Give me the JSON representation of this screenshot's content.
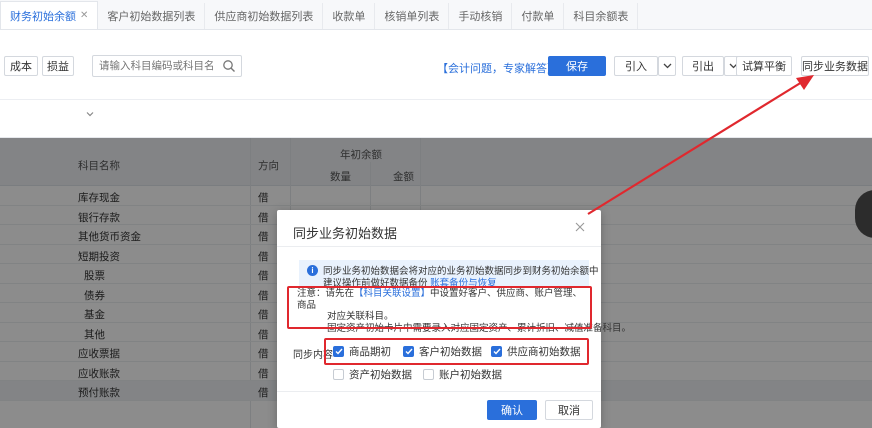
{
  "tabs": [
    {
      "label": "财务初始余额",
      "active": true,
      "closable": true
    },
    {
      "label": "客户初始数据列表"
    },
    {
      "label": "供应商初始数据列表"
    },
    {
      "label": "收款单"
    },
    {
      "label": "核销单列表"
    },
    {
      "label": "手动核销"
    },
    {
      "label": "付款单"
    },
    {
      "label": "科目余额表"
    }
  ],
  "toolbar": {
    "cost_label": "成本",
    "profit_loss_label": "损益",
    "search_placeholder": "请输入科目编码或科目名称",
    "help_link": "【会计问题，专家解答】",
    "save_label": "保存",
    "import_label": "引入",
    "export_label": "引出",
    "trial_balance_label": "试算平衡",
    "sync_label": "同步业务数据"
  },
  "grid": {
    "headers": {
      "account_name": "科目名称",
      "direction": "方向",
      "year_opening": "年初余额",
      "quantity": "数量",
      "amount": "金额"
    },
    "rows": [
      {
        "name": "库存现金",
        "dir": "借",
        "sub": false
      },
      {
        "name": "银行存款",
        "dir": "借",
        "sub": false
      },
      {
        "name": "其他货币资金",
        "dir": "借",
        "sub": false
      },
      {
        "name": "短期投资",
        "dir": "借",
        "sub": false
      },
      {
        "name": "股票",
        "dir": "借",
        "sub": true
      },
      {
        "name": "债券",
        "dir": "借",
        "sub": true
      },
      {
        "name": "基金",
        "dir": "借",
        "sub": true
      },
      {
        "name": "其他",
        "dir": "借",
        "sub": true
      },
      {
        "name": "应收票据",
        "dir": "借",
        "sub": false
      },
      {
        "name": "应收账款",
        "dir": "借",
        "sub": false
      },
      {
        "name": "预付账款",
        "dir": "借",
        "sub": false
      }
    ]
  },
  "modal": {
    "title": "同步业务初始数据",
    "notice_line1": "同步业务初始数据会将对应的业务初始数据同步到财务初始余额中",
    "notice_line2_prefix": "建议操作前做好数据备份",
    "notice_link": "账套备份与恢复",
    "warn_prefix": "注意：请先在",
    "warn_link": "【科目关联设置】",
    "warn_line1_suffix": "中设置好客户、供应商、账户管理、商品",
    "warn_line2": "对应关联科目。",
    "warn_line3": "固定资产初始卡片中需要录入对应固定资产、累计折旧、减值准备科目。",
    "sync_content_label": "同步内容",
    "options": [
      {
        "label": "商品期初",
        "checked": true
      },
      {
        "label": "客户初始数据",
        "checked": true
      },
      {
        "label": "供应商初始数据",
        "checked": true
      },
      {
        "label": "资产初始数据",
        "checked": false
      },
      {
        "label": "账户初始数据",
        "checked": false
      }
    ],
    "confirm_label": "确认",
    "cancel_label": "取消"
  },
  "colors": {
    "primary": "#2a6fdb",
    "highlight_red": "#e0282e"
  }
}
